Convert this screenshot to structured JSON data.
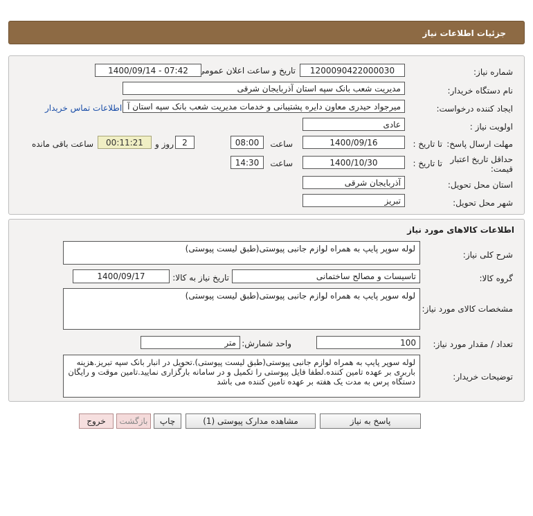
{
  "header": {
    "title": "جزئیات اطلاعات نیاز"
  },
  "info": {
    "need_number_label": "شماره نیاز:",
    "need_number": "1200090422000030",
    "announce_label": "تاریخ و ساعت اعلان عمومی:",
    "announce_value": "1400/09/14 - 07:42",
    "buyer_org_label": "نام دستگاه خریدار:",
    "buyer_org": "مدیریت شعب بانک سپه استان آذربایجان شرقی",
    "requester_label": "ایجاد کننده درخواست:",
    "requester": "میرجواد حیدری معاون دایره پشتیبانی و خدمات مدیریت شعب بانک سپه استان آ",
    "contact_link": "اطلاعات تماس خریدار",
    "priority_label": "اولویت نیاز :",
    "priority": "عادی",
    "deadline_label": "مهلت ارسال پاسخ:",
    "to_date_label": "تا تاریخ :",
    "deadline_date": "1400/09/16",
    "time_label": "ساعت",
    "deadline_time": "08:00",
    "days_value": "2",
    "days_label": "روز و",
    "remaining_time": "00:11:21",
    "remaining_label": "ساعت باقی مانده",
    "validity_label_1": "حداقل تاریخ اعتبار",
    "validity_label_2": "قیمت:",
    "validity_to_label": "تا تاریخ :",
    "validity_date": "1400/10/30",
    "validity_time_label": "ساعت",
    "validity_time": "14:30",
    "province_label": "استان محل تحویل:",
    "province": "آذربایجان شرقی",
    "city_label": "شهر محل تحویل:",
    "city": "تبریز"
  },
  "goods": {
    "section_title": "اطلاعات کالاهای مورد نیاز",
    "summary_label": "شرح کلی نیاز:",
    "summary": "لوله سوپر پایپ به همراه لوازم جانبی پیوستی(طبق لیست پیوستی)",
    "group_label": "گروه کالا:",
    "group": "تاسیسات و مصالح ساختمانی",
    "need_date_label": "تاریخ نیاز به کالا:",
    "need_date": "1400/09/17",
    "spec_label": "مشخصات کالای مورد نیاز:",
    "spec": "لوله سوپر پایپ به همراه لوازم جانبی پیوستی(طبق لیست پیوستی)",
    "qty_label": "تعداد / مقدار مورد نیاز:",
    "qty": "100",
    "unit_label": "واحد شمارش:",
    "unit": "متر",
    "notes_label": "توضیحات خریدار:",
    "notes": "لوله سوپر پایپ به همراه لوازم جانبی پیوستی(طبق لیست پیوستی).تحویل در انبار بانک سپه تبریز.هزینه باربری بر عهده تامین کننده.لطفا فایل پیوستی را تکمیل و در سامانه بارگزاری نمایید.تامین موقت و رایگان دستگاه پرس به مدت یک هفته بر عهده تامین کننده می باشد"
  },
  "buttons": {
    "reply": "پاسخ به نیاز",
    "attachments": "مشاهده مدارک پیوستی (1)",
    "print": "چاپ",
    "back": "بازگشت",
    "exit": "خروج"
  }
}
